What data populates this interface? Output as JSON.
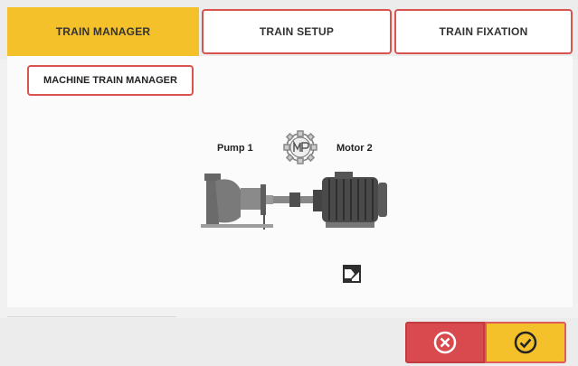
{
  "tabs": [
    {
      "label": "TRAIN MANAGER",
      "active": true
    },
    {
      "label": "TRAIN SETUP",
      "active": false
    },
    {
      "label": "TRAIN FIXATION",
      "active": false
    }
  ],
  "panel": {
    "machine_train_manager_label": "MACHINE TRAIN MANAGER"
  },
  "train": {
    "machine_left": "Pump 1",
    "machine_right": "Motor 2",
    "logo_icon": "coupling-logo-icon",
    "export_icon": "image-export-icon"
  },
  "footer": {
    "cancel_icon": "cancel-circle-icon",
    "confirm_icon": "check-circle-icon"
  },
  "colors": {
    "accent_yellow": "#f4c12a",
    "accent_red": "#d9534f"
  }
}
